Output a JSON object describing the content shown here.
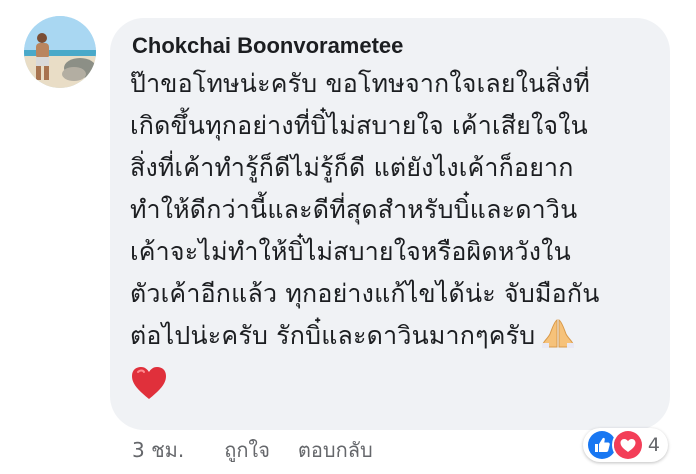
{
  "comment": {
    "author": "Chokchai Boonvorametee",
    "lines": [
      "ป๊าขอโทษน่ะครับ ขอโทษจากใจเลยในสิ่งที่",
      "เกิดขึ้นทุกอย่างที่บิ๋ไม่สบายใจ เค้าเสียใจใน",
      "สิ่งที่เค้าทำรู้ก็ดีไม่รู้ก็ดี แต่ยังไงเค้าก็อยาก",
      "ทำให้ดีกว่านี้และดีที่สุดสำหรับบิ๋และดาวิน",
      "เค้าจะไม่ทำให้บิ๋ไม่สบายใจหรือผิดหวังใน",
      "ตัวเค้าอีกแล้ว ทุกอย่างแก้ไขได้น่ะ จับมือกัน",
      "ต่อไปน่ะครับ รักบิ๋และดาวินมากๆครับ"
    ],
    "emoji_inline": "folded-hands-icon",
    "emoji_bottom": "red-heart-icon"
  },
  "actions": {
    "timestamp": "3 ชม.",
    "like": "ถูกใจ",
    "reply": "ตอบกลับ"
  },
  "reactions": {
    "icons": [
      "like-icon",
      "love-icon"
    ],
    "count": "4",
    "like_color": "#1877f2",
    "love_color": "#f33e58"
  },
  "colors": {
    "bubble": "#f0f2f5",
    "text": "#1c1e21",
    "meta": "#65676b"
  }
}
